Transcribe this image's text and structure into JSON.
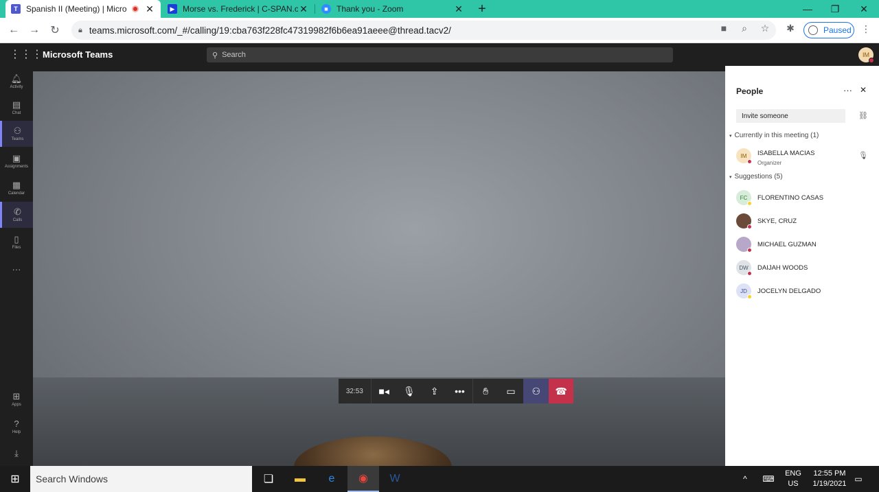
{
  "browser": {
    "tabs": [
      {
        "title": "Spanish II (Meeting) | Micros",
        "recording": true
      },
      {
        "title": "Morse vs. Frederick | C-SPAN.org"
      },
      {
        "title": "Thank you - Zoom"
      }
    ],
    "url": "teams.microsoft.com/_#/calling/19:cba763f228fc47319982f6b6ea91aeee@thread.tacv2/",
    "profile_label": "Paused"
  },
  "teams": {
    "app_title": "Microsoft Teams",
    "search_placeholder": "Search",
    "me_initials": "IM",
    "rail": [
      {
        "label": "Activity",
        "icon": "bell-icon"
      },
      {
        "label": "Chat",
        "icon": "chat-icon"
      },
      {
        "label": "Teams",
        "icon": "teams-icon"
      },
      {
        "label": "Assignments",
        "icon": "assignments-icon"
      },
      {
        "label": "Calendar",
        "icon": "calendar-icon"
      },
      {
        "label": "Calls",
        "icon": "phone-icon"
      },
      {
        "label": "Files",
        "icon": "files-icon"
      }
    ],
    "rail_bottom": [
      {
        "label": "Apps",
        "icon": "apps-icon"
      },
      {
        "label": "Help",
        "icon": "help-icon"
      }
    ]
  },
  "call": {
    "timer": "32:53"
  },
  "people_panel": {
    "title": "People",
    "invite_placeholder": "Invite someone",
    "in_meeting_header": "Currently in this meeting",
    "in_meeting_count": "(1)",
    "in_meeting": [
      {
        "initials": "IM",
        "name": "ISABELLA MACIAS",
        "role": "Organizer",
        "avatar_bg": "#f8e3c0",
        "avatar_fg": "#8a5a00",
        "status": "#c4314b"
      }
    ],
    "suggestions_header": "Suggestions",
    "suggestions_count": "(5)",
    "suggestions": [
      {
        "initials": "FC",
        "name": "FLORENTINO CASAS",
        "avatar_bg": "#d7ecd9",
        "avatar_fg": "#2e7d32",
        "status": "#f8d22a"
      },
      {
        "initials": "",
        "name": "SKYE, CRUZ",
        "avatar_bg": "#6b4a3a",
        "avatar_fg": "#ffffff",
        "status": "#c4314b"
      },
      {
        "initials": "",
        "name": "MICHAEL GUZMAN",
        "avatar_bg": "#b7a7c9",
        "avatar_fg": "#ffffff",
        "status": "#c4314b"
      },
      {
        "initials": "DW",
        "name": "DAIJAH WOODS",
        "avatar_bg": "#dfe3e8",
        "avatar_fg": "#4a5560",
        "status": "#c4314b"
      },
      {
        "initials": "JD",
        "name": "JOCELYN DELGADO",
        "avatar_bg": "#dde3f5",
        "avatar_fg": "#3b4f9c",
        "status": "#f8d22a"
      }
    ]
  },
  "taskbar": {
    "search_placeholder": "Search Windows",
    "lang_top": "ENG",
    "lang_bottom": "US",
    "time": "12:55 PM",
    "date": "1/19/2021"
  },
  "colors": {
    "accent": "#464775",
    "hangup": "#c4314b",
    "tabstrip": "#2fc6a8"
  }
}
